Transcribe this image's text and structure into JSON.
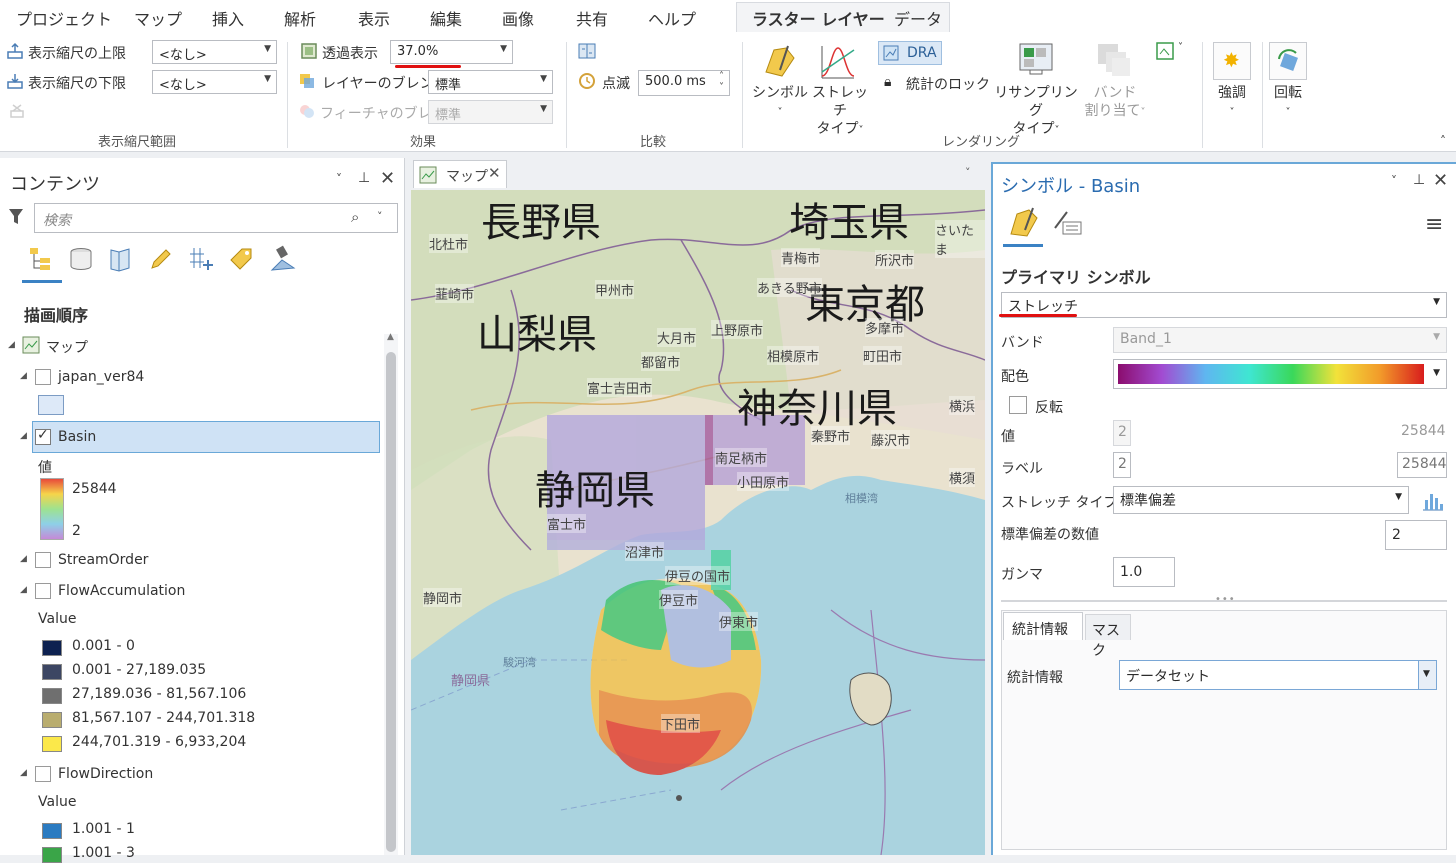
{
  "menu": {
    "items": [
      "プロジェクト",
      "マップ",
      "挿入",
      "解析",
      "表示",
      "編集",
      "画像",
      "共有",
      "ヘルプ"
    ],
    "context_tabs": [
      "ラスター レイヤー",
      "データ"
    ]
  },
  "ribbon": {
    "scale_range": {
      "upper_label": "表示縮尺の上限",
      "lower_label": "表示縮尺の下限",
      "upper_value": "<なし>",
      "lower_value": "<なし>",
      "group": "表示縮尺範囲"
    },
    "effects": {
      "transparency_label": "透過表示",
      "transparency_value": "37.0%",
      "layer_blend_label": "レイヤーのブレンド",
      "layer_blend_value": "標準",
      "feature_blend_label": "フィーチャのブレンド",
      "feature_blend_value": "標準",
      "group": "効果"
    },
    "compare": {
      "flicker_label": "点滅",
      "flicker_value": "500.0  ms",
      "group": "比較"
    },
    "rendering": {
      "symbol_label": "シンボル",
      "stretch_label": "ストレッチ",
      "stretch_label2": "タイプ",
      "dra_label": "DRA",
      "stats_lock_label": "統計のロック",
      "resample_label": "リサンプリング",
      "resample_label2": "タイプ",
      "band_label": "バンド",
      "band_label2": "割り当て",
      "group": "レンダリング"
    },
    "enhance_label": "強調",
    "rotate_label": "回転"
  },
  "contents": {
    "title": "コンテンツ",
    "search_placeholder": "検索",
    "drawing_order": "描画順序",
    "map_name": "マップ",
    "layers": {
      "japan": "japan_ver84",
      "basin": "Basin",
      "basin_value_label": "値",
      "basin_max": "25844",
      "basin_min": "2",
      "stream": "StreamOrder",
      "flowacc": "FlowAccumulation",
      "flowacc_value_label": "Value",
      "flowacc_classes": [
        {
          "label": "0.001 - 0",
          "color": "#0d2150"
        },
        {
          "label": "0.001 - 27,189.035",
          "color": "#3c4663"
        },
        {
          "label": "27,189.036 - 81,567.106",
          "color": "#6f6f6f"
        },
        {
          "label": "81,567.107 - 244,701.318",
          "color": "#b9ad6f"
        },
        {
          "label": "244,701.319 - 6,933,204",
          "color": "#fbe84a"
        }
      ],
      "flowdir": "FlowDirection",
      "flowdir_value_label": "Value",
      "flowdir_classes": [
        {
          "label": "1.001 - 1",
          "color": "#2b7bc1"
        },
        {
          "label": "1.001 - 3",
          "color": "#3aa548"
        }
      ]
    }
  },
  "map": {
    "tab": "マップ",
    "labels": {
      "nagano": "長野県",
      "saitama": "埼玉県",
      "yamanashi": "山梨県",
      "tokyo": "東京都",
      "kanagawa": "神奈川県",
      "shizuoka": "静岡県"
    },
    "cities": [
      "北杜市",
      "韮崎市",
      "甲州市",
      "青梅市",
      "所沢市",
      "あきる野市",
      "大月市",
      "上野原市",
      "都留市",
      "多摩市",
      "富士吉田市",
      "相模原市",
      "町田市",
      "秦野市",
      "藤沢市",
      "南足柄市",
      "小田原市",
      "富士市",
      "沼津市",
      "伊豆の国市",
      "伊豆市",
      "伊東市",
      "静岡市",
      "下田市",
      "相模湾",
      "駿河湾",
      "静岡県",
      "さいたま",
      "横浜",
      "横須"
    ]
  },
  "symbology": {
    "title": "シンボル - Basin",
    "primary_symbol_label": "プライマリ シンボル",
    "primary_symbol_value": "ストレッチ",
    "band_label": "バンド",
    "band_value": "Band_1",
    "color_scheme_label": "配色",
    "invert_label": "反転",
    "value_label": "値",
    "value_min": "2",
    "value_max": "25844",
    "label_label": "ラベル",
    "label_min": "2",
    "label_max": "25844",
    "stretch_type_label": "ストレッチ タイプ",
    "stretch_type_value": "標準偏差",
    "stddev_label": "標準偏差の数値",
    "stddev_value": "2",
    "gamma_label": "ガンマ",
    "gamma_value": "1.0",
    "tabs": [
      "統計情報",
      "マスク"
    ],
    "stats_label": "統計情報",
    "stats_value": "データセット"
  }
}
